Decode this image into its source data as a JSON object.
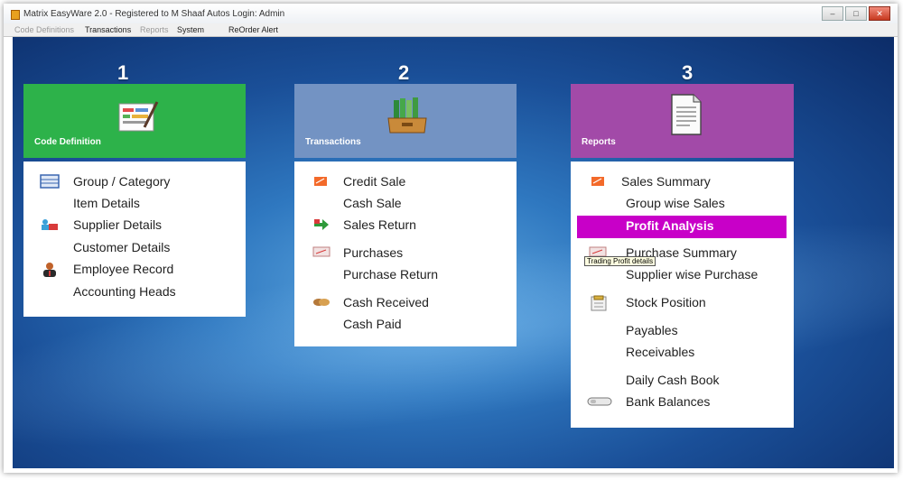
{
  "window": {
    "title": "Matrix EasyWare 2.0 - Registered to M Shaaf Autos Login: Admin"
  },
  "menu": [
    "Code Definitions",
    "Transactions",
    "Reports",
    "System",
    "ReOrder Alert"
  ],
  "panels": [
    {
      "number": "1",
      "title": "Code Definition",
      "head_color": "#2db24a",
      "items": [
        "Group / Category",
        "Item Details",
        "Supplier Details",
        "Customer Details",
        "Employee Record",
        "Accounting Heads"
      ]
    },
    {
      "number": "2",
      "title": "Transactions",
      "head_color": "#7393c3",
      "items": [
        "Credit Sale",
        "Cash Sale",
        "Sales Return",
        "Purchases",
        "Purchase Return",
        "Cash Received",
        "Cash Paid"
      ]
    },
    {
      "number": "3",
      "title": "Reports",
      "head_color": "#a24aa8",
      "items": [
        "Sales Summary",
        "Group wise Sales",
        "Profit Analysis",
        "Purchase Summary",
        "Supplier wise Purchase",
        "Stock Position",
        "Payables",
        "Receivables",
        "Daily Cash Book",
        "Bank Balances"
      ]
    }
  ],
  "tooltip": "Trading Profit details",
  "highlight_color": "#c800c8"
}
